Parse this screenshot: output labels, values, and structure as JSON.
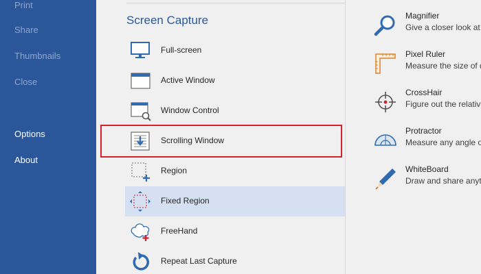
{
  "sidebar": {
    "items": [
      {
        "label": "Print",
        "active": false
      },
      {
        "label": "Share",
        "active": false
      },
      {
        "label": "Thumbnails",
        "active": false
      },
      {
        "label": "Close",
        "active": false
      },
      {
        "label": "Options",
        "active": true
      },
      {
        "label": "About",
        "active": true
      }
    ]
  },
  "main": {
    "section_title": "Screen Capture",
    "capture_items": [
      {
        "label": "Full-screen",
        "icon": "monitor-icon"
      },
      {
        "label": "Active Window",
        "icon": "window-icon"
      },
      {
        "label": "Window Control",
        "icon": "window-control-icon"
      },
      {
        "label": "Scrolling Window",
        "icon": "scrolling-window-icon"
      },
      {
        "label": "Region",
        "icon": "region-icon"
      },
      {
        "label": "Fixed Region",
        "icon": "fixed-region-icon",
        "selected": true
      },
      {
        "label": "FreeHand",
        "icon": "freehand-icon"
      },
      {
        "label": "Repeat Last Capture",
        "icon": "repeat-icon"
      }
    ],
    "tools": [
      {
        "name": "Magnifier",
        "desc": "Give a closer look at",
        "icon": "magnifier-icon"
      },
      {
        "name": "Pixel Ruler",
        "desc": "Measure the size of d",
        "icon": "ruler-icon"
      },
      {
        "name": "CrossHair",
        "desc": "Figure out the relativ",
        "icon": "crosshair-icon"
      },
      {
        "name": "Protractor",
        "desc": "Measure any angle o",
        "icon": "protractor-icon"
      },
      {
        "name": "WhiteBoard",
        "desc": "Draw and share anyth",
        "icon": "pen-icon"
      }
    ]
  },
  "colors": {
    "sidebar_bg": "#2b579a",
    "accent": "#2b579a",
    "highlight_border": "#d3202a",
    "selected_bg": "#d5e1f2",
    "icon_blue": "#2e6bb0",
    "icon_orange": "#d9822b"
  }
}
